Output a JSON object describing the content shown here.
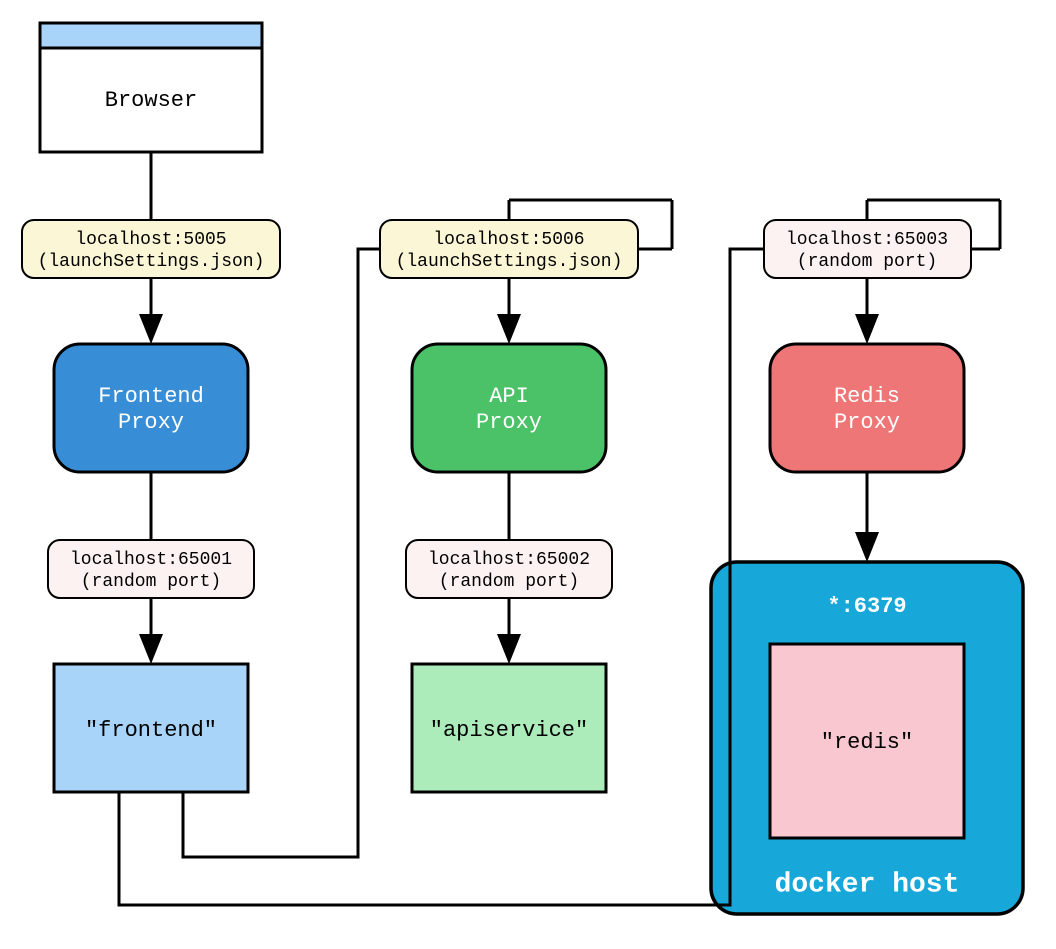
{
  "nodes": {
    "browser": {
      "label": "Browser"
    },
    "frontend_proxy": {
      "line1": "Frontend",
      "line2": "Proxy"
    },
    "api_proxy": {
      "line1": "API",
      "line2": "Proxy"
    },
    "redis_proxy": {
      "line1": "Redis",
      "line2": "Proxy"
    },
    "frontend": {
      "label": "\"frontend\""
    },
    "apiservice": {
      "label": "\"apiservice\""
    },
    "redis": {
      "label": "\"redis\""
    },
    "docker_host": {
      "title": "docker host",
      "port": "*:6379"
    }
  },
  "edges": {
    "e1": {
      "line1": "localhost:5005",
      "line2": "(launchSettings.json)"
    },
    "e2": {
      "line1": "localhost:5006",
      "line2": "(launchSettings.json)"
    },
    "e3": {
      "line1": "localhost:65003",
      "line2": "(random port)"
    },
    "e4": {
      "line1": "localhost:65001",
      "line2": "(random port)"
    },
    "e5": {
      "line1": "localhost:65002",
      "line2": "(random port)"
    }
  },
  "colors": {
    "browser_title": "#a7d4f8",
    "frontend_proxy": "#378ed6",
    "api_proxy": "#4bc168",
    "redis_proxy": "#ef7676",
    "frontend": "#a7d4f8",
    "apiservice": "#acecbb",
    "redis": "#f9c7cf",
    "docker": "#17a8d9",
    "edge_label_yellow": "#fbf6d5",
    "edge_label_pink": "#fdf2f2"
  }
}
